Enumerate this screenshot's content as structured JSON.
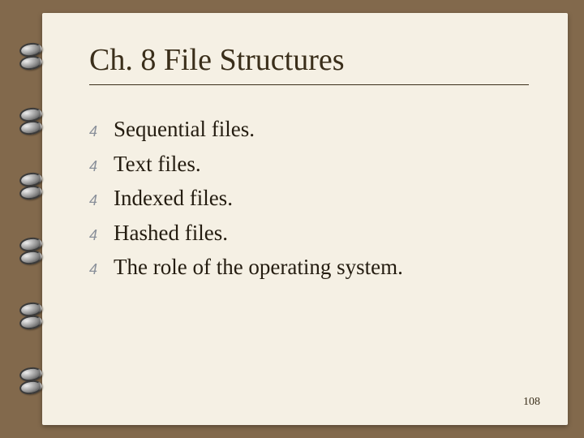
{
  "slide": {
    "title": "Ch. 8 File Structures",
    "bullets": [
      {
        "text": "Sequential files."
      },
      {
        "text": "Text files."
      },
      {
        "text": "Indexed files."
      },
      {
        "text": "Hashed files."
      },
      {
        "text": "The role of the operating system."
      }
    ],
    "bullet_glyph": "4",
    "page_number": "108"
  }
}
